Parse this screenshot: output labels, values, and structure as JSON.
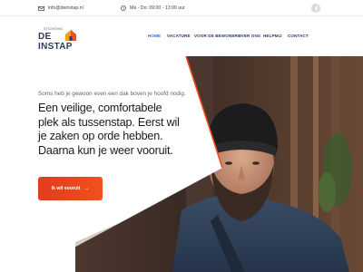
{
  "topbar": {
    "email": "info@deinstap.nl",
    "hours": "Ma - Do: 09:00 - 13:00 uur",
    "email_icon": "envelope-icon",
    "hours_icon": "clock-icon",
    "social_icon": "facebook-icon"
  },
  "logo": {
    "small_text": "STICHTING",
    "big_text": "DE INSTAP"
  },
  "nav": {
    "items": [
      {
        "label": "HOME",
        "active": true
      },
      {
        "label": "VACATURE",
        "active": false
      },
      {
        "label": "VOOR DE BEWONERS",
        "active": false
      },
      {
        "label": "OVER ONS",
        "active": false
      },
      {
        "label": "HELPMIJ",
        "active": false
      },
      {
        "label": "CONTACT",
        "active": false
      }
    ]
  },
  "hero": {
    "subtitle": "Soms heb je gewoon even een dak boven je hoofd nodig.",
    "title": "Een veilige, comfortabele plek als tussenstap. Eerst wil je zaken op orde hebben. Daarna kun je weer vooruit.",
    "cta_label": "Ik wil vooruit",
    "cta_icon": "arrow-right-icon"
  },
  "colors": {
    "accent": "#f04a1e",
    "nav_active": "#2b6cc4",
    "nav_text": "#2d3a5a"
  }
}
